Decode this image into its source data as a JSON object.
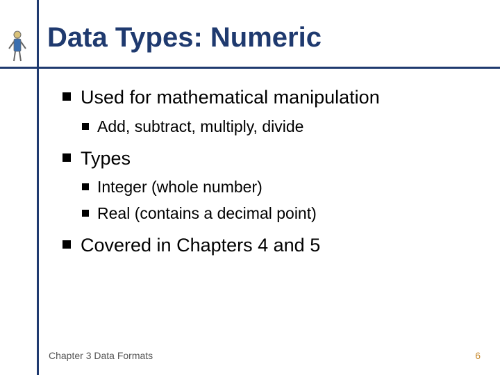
{
  "title": "Data Types: Numeric",
  "bullets": [
    {
      "text": "Used for mathematical manipulation",
      "children": [
        {
          "text": "Add, subtract, multiply, divide"
        }
      ]
    },
    {
      "text": "Types",
      "children": [
        {
          "text": "Integer (whole number)"
        },
        {
          "text": "Real (contains a decimal point)"
        }
      ]
    },
    {
      "text": "Covered in Chapters 4 and 5",
      "children": []
    }
  ],
  "footer": {
    "left": "Chapter 3 Data Formats",
    "right": "6"
  }
}
